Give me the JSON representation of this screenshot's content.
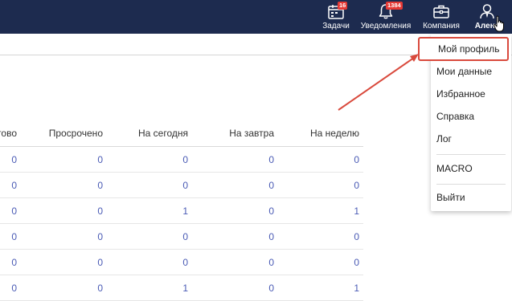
{
  "navbar": {
    "items": [
      {
        "label": "Задачи",
        "icon": "calendar-icon",
        "badge": "16"
      },
      {
        "label": "Уведомления",
        "icon": "bell-icon",
        "badge": "1384"
      },
      {
        "label": "Компания",
        "icon": "briefcase-icon"
      },
      {
        "label": "Алена",
        "icon": "user-icon"
      }
    ]
  },
  "table": {
    "headers": [
      "тово",
      "Просрочено",
      "На сегодня",
      "На завтра",
      "На неделю"
    ],
    "rows": [
      [
        "0",
        "0",
        "0",
        "0",
        "0"
      ],
      [
        "0",
        "0",
        "0",
        "0",
        "0"
      ],
      [
        "0",
        "0",
        "1",
        "0",
        "1"
      ],
      [
        "0",
        "0",
        "0",
        "0",
        "0"
      ],
      [
        "0",
        "0",
        "0",
        "0",
        "0"
      ],
      [
        "0",
        "0",
        "1",
        "0",
        "1"
      ]
    ]
  },
  "user_menu": {
    "items": [
      "Мой профиль",
      "Мои данные",
      "Избранное",
      "Справка",
      "Лог",
      "MACRO",
      "Выйти"
    ]
  },
  "colors": {
    "navbar": "#1d2b4f",
    "badge": "#e53935",
    "highlight": "#d94a3d",
    "link_value": "#4a5bb5"
  }
}
